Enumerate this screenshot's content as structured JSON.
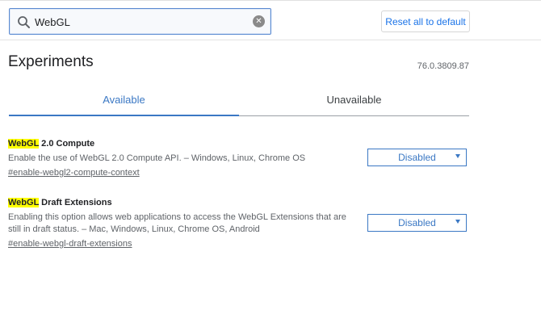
{
  "header": {
    "search": {
      "value": "WebGL",
      "clear_icon": "clear-icon"
    },
    "reset_label": "Reset all to default"
  },
  "main": {
    "title": "Experiments",
    "version": "76.0.3809.87",
    "tabs": [
      {
        "label": "Available",
        "selected": true
      },
      {
        "label": "Unavailable",
        "selected": false
      }
    ],
    "experiments": [
      {
        "title_highlight": "WebGL",
        "title_rest": " 2.0 Compute",
        "description": "Enable the use of WebGL 2.0 Compute API. – Windows, Linux, Chrome OS",
        "link": "#enable-webgl2-compute-context",
        "state": "Disabled"
      },
      {
        "title_highlight": "WebGL",
        "title_rest": " Draft Extensions",
        "description": "Enabling this option allows web applications to access the WebGL Extensions that are still in draft status. – Mac, Windows, Linux, Chrome OS, Android",
        "link": "#enable-webgl-draft-extensions",
        "state": "Disabled"
      }
    ]
  },
  "colors": {
    "accent": "#3b78c4",
    "highlight": "#ffff00",
    "reset_text": "#1a73e8"
  }
}
